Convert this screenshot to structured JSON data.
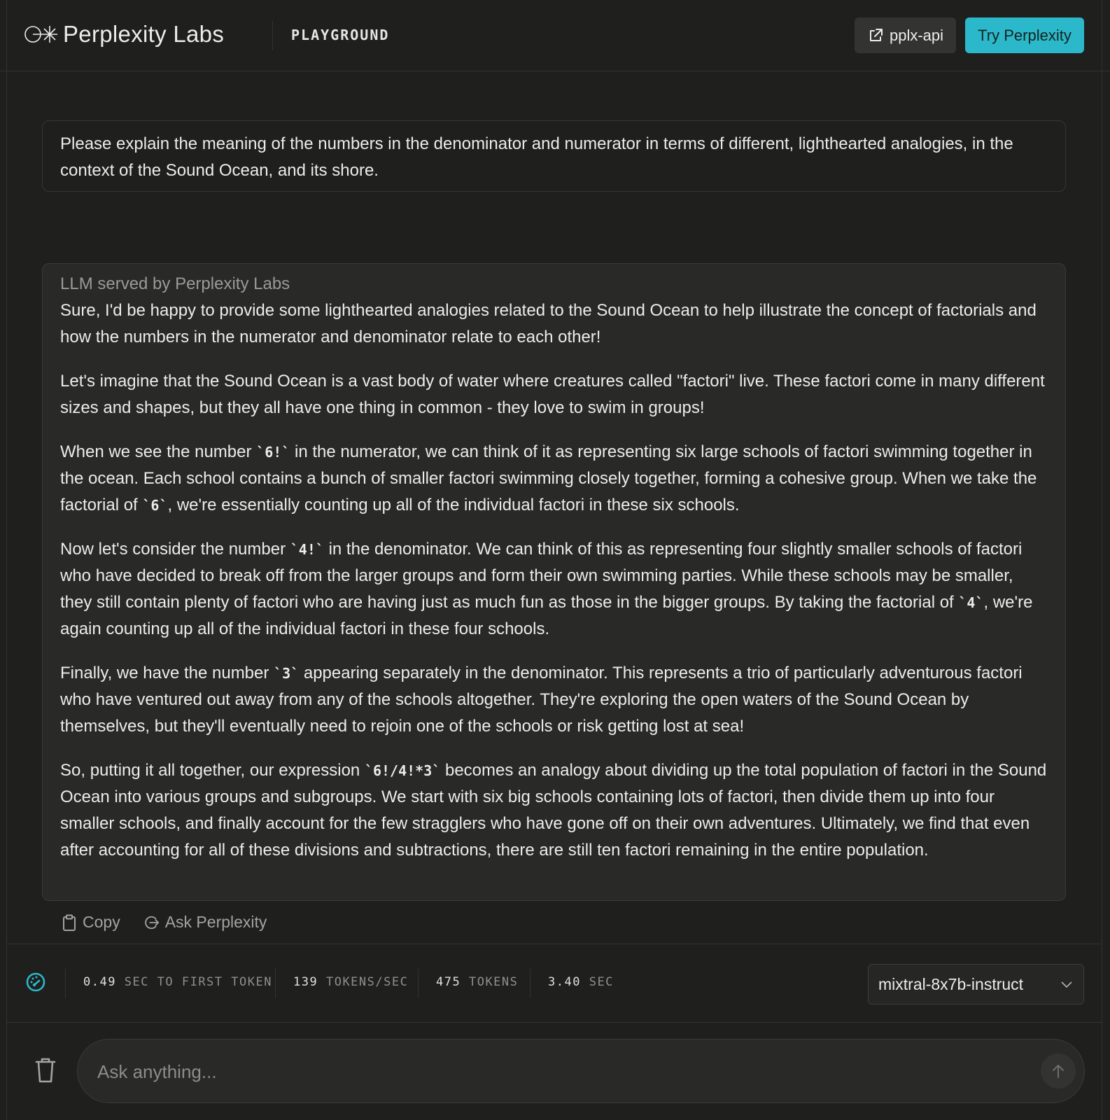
{
  "header": {
    "brand": "Perplexity Labs",
    "section": "PLAYGROUND",
    "api_button": "pplx-api",
    "try_button": "Try Perplexity",
    "accent_color": "#2bb8cb"
  },
  "user_message": "Please explain the meaning of the numbers in the denominator and numerator in terms of different, lighthearted analogies, in the context of the Sound Ocean, and its shore.",
  "answer": {
    "label": "LLM served by Perplexity Labs",
    "paragraphs": [
      [
        {
          "t": "Sure, I'd be happy to provide some lighthearted analogies related to the Sound Ocean to help illustrate the concept of factorials and how the numbers in the numerator and denominator relate to each other!"
        }
      ],
      [
        {
          "t": "Let's imagine that the Sound Ocean is a vast body of water where creatures called \"factori\" live. These factori come in many different sizes and shapes, but they all have one thing in common - they love to swim in groups!"
        }
      ],
      [
        {
          "t": "When we see the number "
        },
        {
          "c": "`6!`"
        },
        {
          "t": " in the numerator, we can think of it as representing six large schools of factori swimming together in the ocean. Each school contains a bunch of smaller factori swimming closely together, forming a cohesive group. When we take the factorial of "
        },
        {
          "c": "`6`"
        },
        {
          "t": ", we're essentially counting up all of the individual factori in these six schools."
        }
      ],
      [
        {
          "t": "Now let's consider the number "
        },
        {
          "c": "`4!`"
        },
        {
          "t": " in the denominator. We can think of this as representing four slightly smaller schools of factori who have decided to break off from the larger groups and form their own swimming parties. While these schools may be smaller, they still contain plenty of factori who are having just as much fun as those in the bigger groups. By taking the factorial of "
        },
        {
          "c": "`4`"
        },
        {
          "t": ", we're again counting up all of the individual factori in these four schools."
        }
      ],
      [
        {
          "t": "Finally, we have the number "
        },
        {
          "c": "`3`"
        },
        {
          "t": " appearing separately in the denominator. This represents a trio of particularly adventurous factori who have ventured out away from any of the schools altogether. They're exploring the open waters of the Sound Ocean by themselves, but they'll eventually need to rejoin one of the schools or risk getting lost at sea!"
        }
      ],
      [
        {
          "t": "So, putting it all together, our expression "
        },
        {
          "c": "`6!/4!*3`"
        },
        {
          "t": " becomes an analogy about dividing up the total population of factori in the Sound Ocean into various groups and subgroups. We start with six big schools containing lots of factori, then divide them up into four smaller schools, and finally account for the few stragglers who have gone off on their own adventures. Ultimately, we find that even after accounting for all of these divisions and subtractions, there are still ten factori remaining in the entire population."
        }
      ]
    ]
  },
  "actions": {
    "copy": "Copy",
    "ask": "Ask Perplexity"
  },
  "stats": [
    {
      "value": "0.49",
      "unit": "SEC TO FIRST TOKEN"
    },
    {
      "value": "139",
      "unit": "TOKENS/SEC"
    },
    {
      "value": "475",
      "unit": "TOKENS"
    },
    {
      "value": "3.40",
      "unit": "SEC"
    }
  ],
  "model": {
    "selected": "mixtral-8x7b-instruct"
  },
  "input": {
    "value": "",
    "placeholder": "Ask anything..."
  }
}
